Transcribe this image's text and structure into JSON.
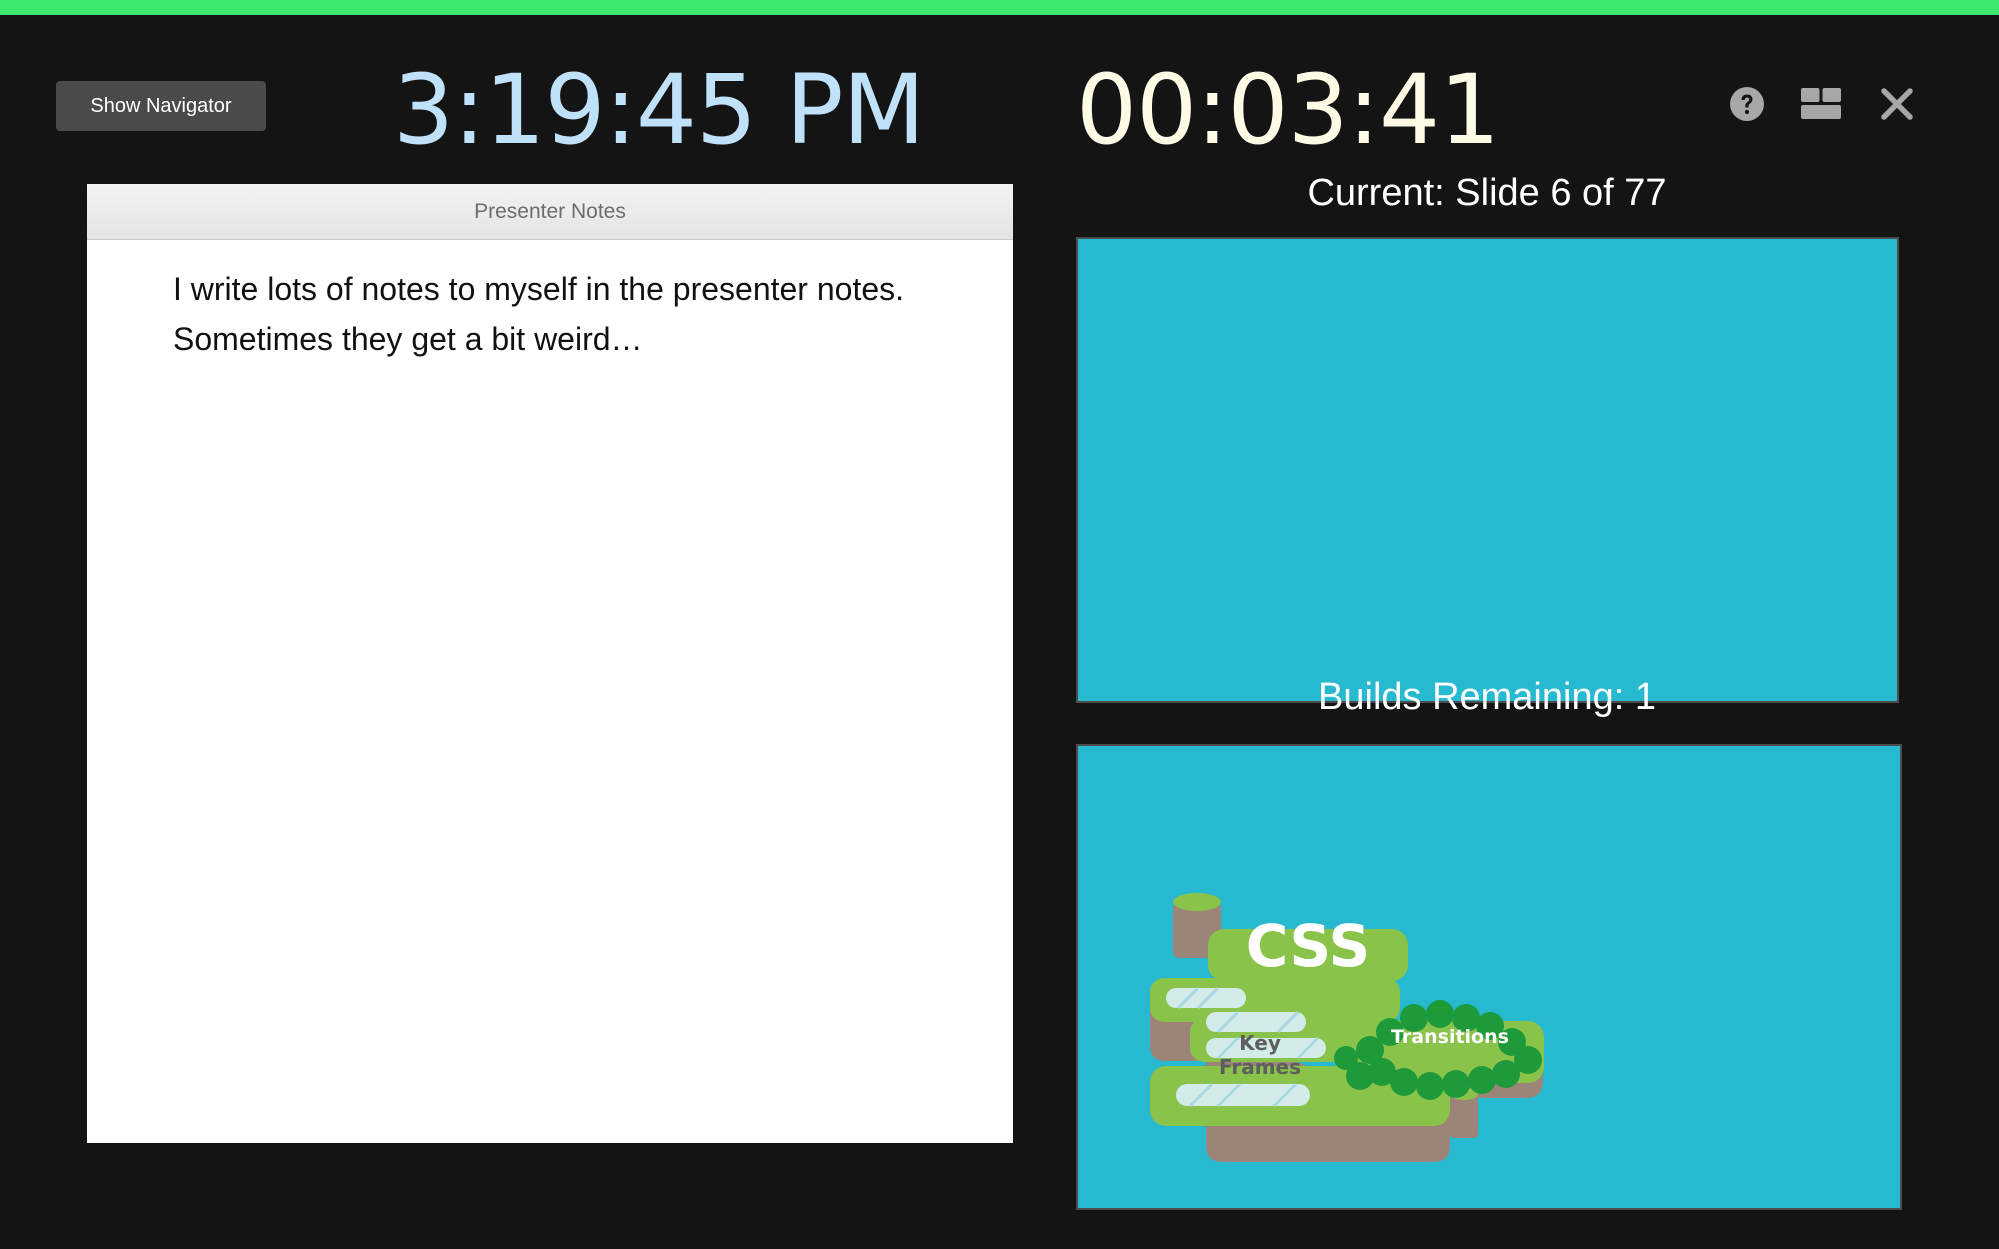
{
  "colors": {
    "top_bar": "#3ee86f",
    "background": "#141414",
    "clock": "#bfe2fa",
    "timer": "#fdfbe6",
    "slide_bg": "#26b9d0",
    "icon": "#a7a7a7"
  },
  "toolbar": {
    "navigator_label": "Show Navigator",
    "clock": "3:19:45 PM",
    "timer": "00:03:41",
    "icons": [
      "help-icon",
      "layout-icon",
      "close-icon"
    ]
  },
  "notes": {
    "header": "Presenter Notes",
    "text": "I write lots of notes to myself in the presenter notes. Sometimes they get a bit weird…"
  },
  "current_slide": {
    "label": "Current: Slide 6 of 77"
  },
  "next_slide": {
    "label": "Builds Remaining: 1",
    "art": {
      "title": "CSS",
      "left_label_line1": "Key",
      "left_label_line2": "Frames",
      "right_label": "Transitions"
    }
  }
}
